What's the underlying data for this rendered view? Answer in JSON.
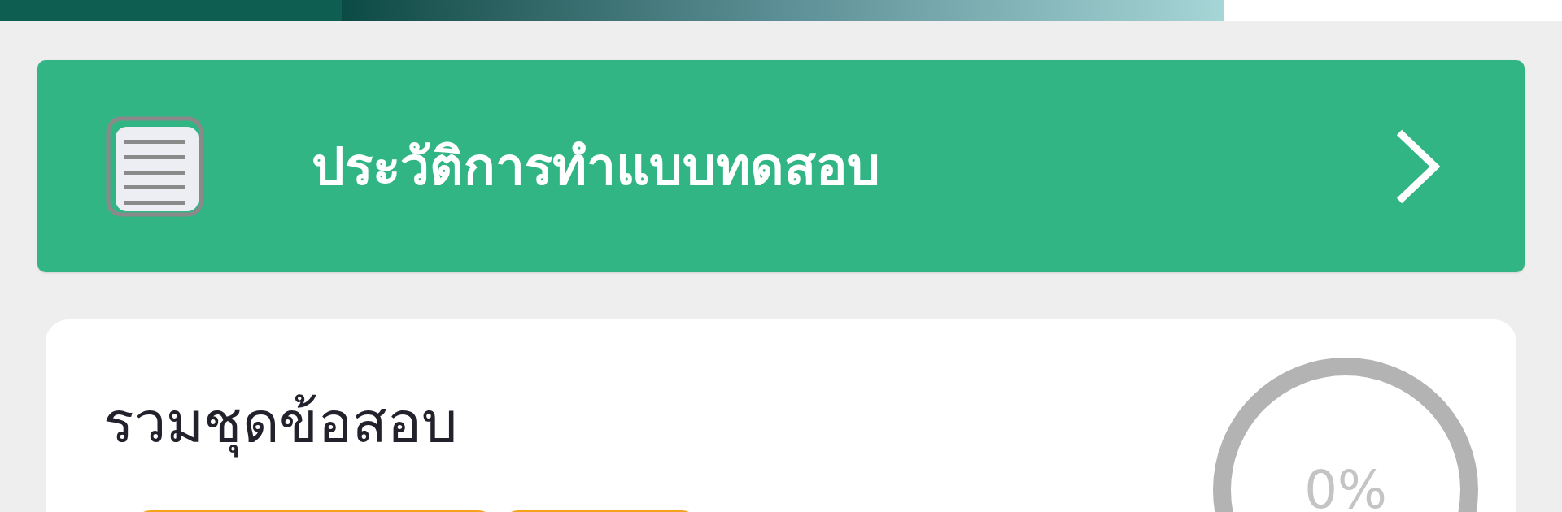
{
  "history_button": {
    "label": "ประวัติการทำแบบทดสอบ"
  },
  "exam_card": {
    "title": "รวมชุดข้อสอบ",
    "progress": {
      "reading": "0%"
    }
  }
}
